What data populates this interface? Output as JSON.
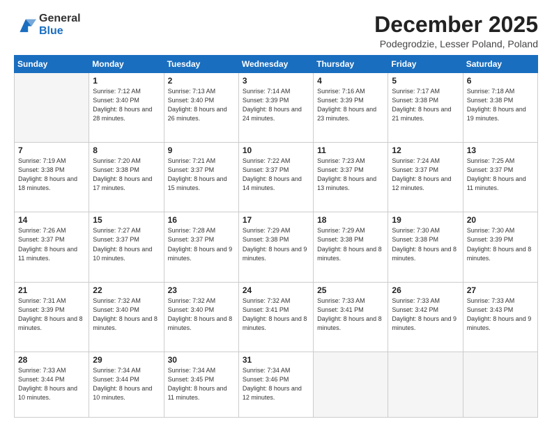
{
  "header": {
    "logo_general": "General",
    "logo_blue": "Blue",
    "month_title": "December 2025",
    "location": "Podegrodzie, Lesser Poland, Poland"
  },
  "weekdays": [
    "Sunday",
    "Monday",
    "Tuesday",
    "Wednesday",
    "Thursday",
    "Friday",
    "Saturday"
  ],
  "weeks": [
    [
      {
        "day": "",
        "sunrise": "",
        "sunset": "",
        "daylight": ""
      },
      {
        "day": "1",
        "sunrise": "Sunrise: 7:12 AM",
        "sunset": "Sunset: 3:40 PM",
        "daylight": "Daylight: 8 hours and 28 minutes."
      },
      {
        "day": "2",
        "sunrise": "Sunrise: 7:13 AM",
        "sunset": "Sunset: 3:40 PM",
        "daylight": "Daylight: 8 hours and 26 minutes."
      },
      {
        "day": "3",
        "sunrise": "Sunrise: 7:14 AM",
        "sunset": "Sunset: 3:39 PM",
        "daylight": "Daylight: 8 hours and 24 minutes."
      },
      {
        "day": "4",
        "sunrise": "Sunrise: 7:16 AM",
        "sunset": "Sunset: 3:39 PM",
        "daylight": "Daylight: 8 hours and 23 minutes."
      },
      {
        "day": "5",
        "sunrise": "Sunrise: 7:17 AM",
        "sunset": "Sunset: 3:38 PM",
        "daylight": "Daylight: 8 hours and 21 minutes."
      },
      {
        "day": "6",
        "sunrise": "Sunrise: 7:18 AM",
        "sunset": "Sunset: 3:38 PM",
        "daylight": "Daylight: 8 hours and 19 minutes."
      }
    ],
    [
      {
        "day": "7",
        "sunrise": "Sunrise: 7:19 AM",
        "sunset": "Sunset: 3:38 PM",
        "daylight": "Daylight: 8 hours and 18 minutes."
      },
      {
        "day": "8",
        "sunrise": "Sunrise: 7:20 AM",
        "sunset": "Sunset: 3:38 PM",
        "daylight": "Daylight: 8 hours and 17 minutes."
      },
      {
        "day": "9",
        "sunrise": "Sunrise: 7:21 AM",
        "sunset": "Sunset: 3:37 PM",
        "daylight": "Daylight: 8 hours and 15 minutes."
      },
      {
        "day": "10",
        "sunrise": "Sunrise: 7:22 AM",
        "sunset": "Sunset: 3:37 PM",
        "daylight": "Daylight: 8 hours and 14 minutes."
      },
      {
        "day": "11",
        "sunrise": "Sunrise: 7:23 AM",
        "sunset": "Sunset: 3:37 PM",
        "daylight": "Daylight: 8 hours and 13 minutes."
      },
      {
        "day": "12",
        "sunrise": "Sunrise: 7:24 AM",
        "sunset": "Sunset: 3:37 PM",
        "daylight": "Daylight: 8 hours and 12 minutes."
      },
      {
        "day": "13",
        "sunrise": "Sunrise: 7:25 AM",
        "sunset": "Sunset: 3:37 PM",
        "daylight": "Daylight: 8 hours and 11 minutes."
      }
    ],
    [
      {
        "day": "14",
        "sunrise": "Sunrise: 7:26 AM",
        "sunset": "Sunset: 3:37 PM",
        "daylight": "Daylight: 8 hours and 11 minutes."
      },
      {
        "day": "15",
        "sunrise": "Sunrise: 7:27 AM",
        "sunset": "Sunset: 3:37 PM",
        "daylight": "Daylight: 8 hours and 10 minutes."
      },
      {
        "day": "16",
        "sunrise": "Sunrise: 7:28 AM",
        "sunset": "Sunset: 3:37 PM",
        "daylight": "Daylight: 8 hours and 9 minutes."
      },
      {
        "day": "17",
        "sunrise": "Sunrise: 7:29 AM",
        "sunset": "Sunset: 3:38 PM",
        "daylight": "Daylight: 8 hours and 9 minutes."
      },
      {
        "day": "18",
        "sunrise": "Sunrise: 7:29 AM",
        "sunset": "Sunset: 3:38 PM",
        "daylight": "Daylight: 8 hours and 8 minutes."
      },
      {
        "day": "19",
        "sunrise": "Sunrise: 7:30 AM",
        "sunset": "Sunset: 3:38 PM",
        "daylight": "Daylight: 8 hours and 8 minutes."
      },
      {
        "day": "20",
        "sunrise": "Sunrise: 7:30 AM",
        "sunset": "Sunset: 3:39 PM",
        "daylight": "Daylight: 8 hours and 8 minutes."
      }
    ],
    [
      {
        "day": "21",
        "sunrise": "Sunrise: 7:31 AM",
        "sunset": "Sunset: 3:39 PM",
        "daylight": "Daylight: 8 hours and 8 minutes."
      },
      {
        "day": "22",
        "sunrise": "Sunrise: 7:32 AM",
        "sunset": "Sunset: 3:40 PM",
        "daylight": "Daylight: 8 hours and 8 minutes."
      },
      {
        "day": "23",
        "sunrise": "Sunrise: 7:32 AM",
        "sunset": "Sunset: 3:40 PM",
        "daylight": "Daylight: 8 hours and 8 minutes."
      },
      {
        "day": "24",
        "sunrise": "Sunrise: 7:32 AM",
        "sunset": "Sunset: 3:41 PM",
        "daylight": "Daylight: 8 hours and 8 minutes."
      },
      {
        "day": "25",
        "sunrise": "Sunrise: 7:33 AM",
        "sunset": "Sunset: 3:41 PM",
        "daylight": "Daylight: 8 hours and 8 minutes."
      },
      {
        "day": "26",
        "sunrise": "Sunrise: 7:33 AM",
        "sunset": "Sunset: 3:42 PM",
        "daylight": "Daylight: 8 hours and 9 minutes."
      },
      {
        "day": "27",
        "sunrise": "Sunrise: 7:33 AM",
        "sunset": "Sunset: 3:43 PM",
        "daylight": "Daylight: 8 hours and 9 minutes."
      }
    ],
    [
      {
        "day": "28",
        "sunrise": "Sunrise: 7:33 AM",
        "sunset": "Sunset: 3:44 PM",
        "daylight": "Daylight: 8 hours and 10 minutes."
      },
      {
        "day": "29",
        "sunrise": "Sunrise: 7:34 AM",
        "sunset": "Sunset: 3:44 PM",
        "daylight": "Daylight: 8 hours and 10 minutes."
      },
      {
        "day": "30",
        "sunrise": "Sunrise: 7:34 AM",
        "sunset": "Sunset: 3:45 PM",
        "daylight": "Daylight: 8 hours and 11 minutes."
      },
      {
        "day": "31",
        "sunrise": "Sunrise: 7:34 AM",
        "sunset": "Sunset: 3:46 PM",
        "daylight": "Daylight: 8 hours and 12 minutes."
      },
      {
        "day": "",
        "sunrise": "",
        "sunset": "",
        "daylight": ""
      },
      {
        "day": "",
        "sunrise": "",
        "sunset": "",
        "daylight": ""
      },
      {
        "day": "",
        "sunrise": "",
        "sunset": "",
        "daylight": ""
      }
    ]
  ]
}
